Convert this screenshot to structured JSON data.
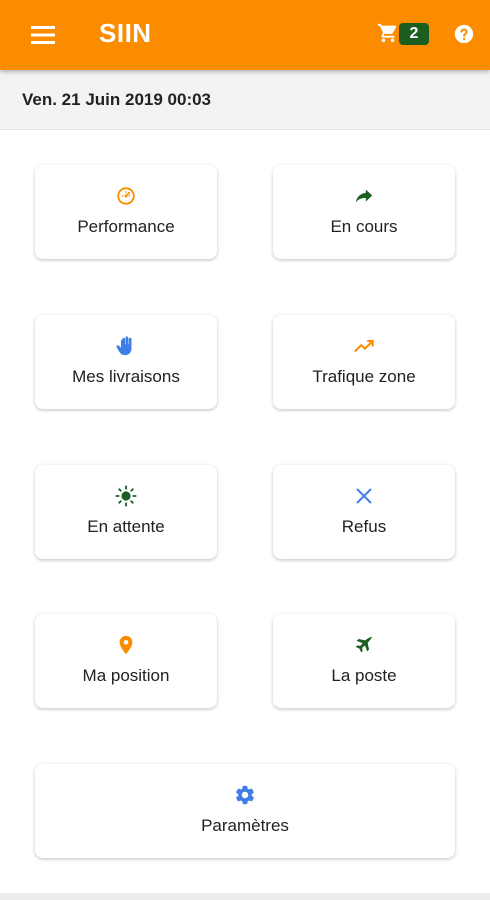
{
  "appbar": {
    "title": "SIIN",
    "cart_count": "2",
    "menu_icon": "hamburger-menu-icon",
    "cart_icon": "shopping-cart-icon",
    "help_icon": "help-circle-icon"
  },
  "datebar": {
    "date": "Ven. 21 Juin 2019 00:03"
  },
  "tiles": [
    {
      "label": "Performance",
      "icon": "speedometer-icon",
      "color": "#fb8c00"
    },
    {
      "label": "En cours",
      "icon": "forward-arrow-icon",
      "color": "#1b5e20"
    },
    {
      "label": "Mes livraisons",
      "icon": "hand-icon",
      "color": "#3f7ee8"
    },
    {
      "label": "Trafique zone",
      "icon": "trending-up-icon",
      "color": "#fb8c00"
    },
    {
      "label": "En attente",
      "icon": "sun-icon",
      "color": "#1b5e20"
    },
    {
      "label": "Refus",
      "icon": "close-icon",
      "color": "#3f7ee8"
    },
    {
      "label": "Ma position",
      "icon": "map-pin-icon",
      "color": "#fb8c00"
    },
    {
      "label": "La poste",
      "icon": "airplane-icon",
      "color": "#1b5e20"
    },
    {
      "label": "Paramètres",
      "icon": "gear-icon",
      "color": "#3f7ee8"
    }
  ],
  "colors": {
    "primary": "#fb8c00",
    "badge": "#1b5e20",
    "accent_blue": "#3f7ee8"
  }
}
